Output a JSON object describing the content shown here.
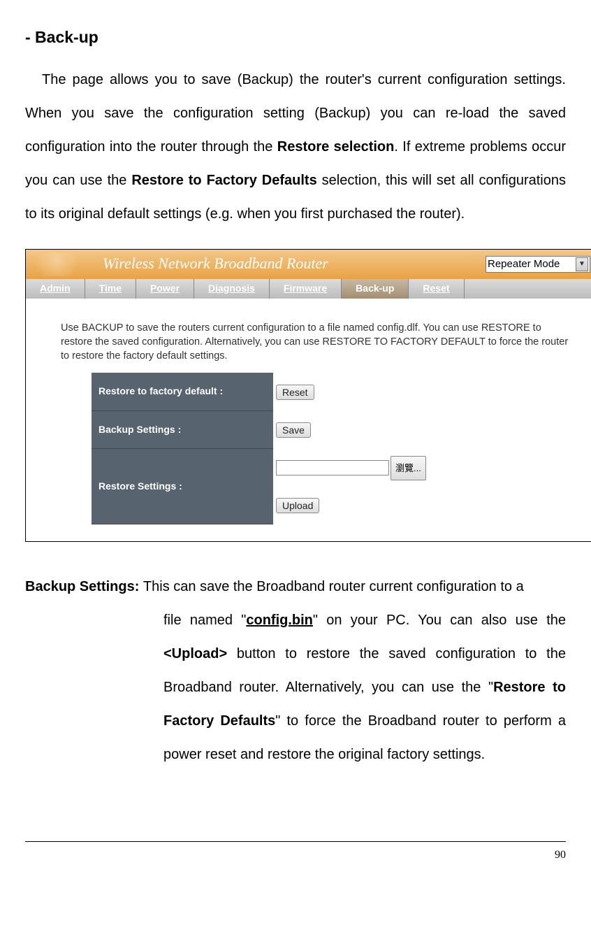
{
  "heading": "- Back-up",
  "intro": {
    "p1a": "The page allows you to save (Backup) the router's current configuration settings. When you save the configuration setting (Backup) you can re-load the saved configuration into the router through the ",
    "b1": "Restore selection",
    "p1b": ". If extreme problems occur you can use the ",
    "b2": "Restore to Factory Defaults",
    "p1c": " selection, this will set all configurations to its original default settings (e.g. when you first purchased the router)."
  },
  "router": {
    "title": "Wireless Network Broadband Router",
    "mode": "Repeater Mode",
    "tabs": [
      "Admin",
      "Time",
      "Power",
      "Diagnosis",
      "Firmware",
      "Back-up",
      "Reset"
    ],
    "active_tab": "Back-up",
    "desc": "Use BACKUP to save the routers current configuration to a file named config.dlf. You can use RESTORE to restore the saved configuration. Alternatively, you can use RESTORE TO FACTORY DEFAULT to force the router to restore the factory default settings.",
    "rows": {
      "factory_label": "Restore to factory default :",
      "factory_btn": "Reset",
      "backup_label": "Backup Settings :",
      "backup_btn": "Save",
      "restore_label": "Restore Settings :",
      "browse_btn": "瀏覽...",
      "upload_btn": "Upload"
    }
  },
  "definition": {
    "label": "Backup Settings: ",
    "line1_a": "This can save the Broadband router current configuration to a",
    "body_a": "file named \"",
    "config": "config.bin",
    "body_b": "\" on your PC. You can also use the ",
    "upload": "<Upload>",
    "body_c": " button to restore the saved configuration to the Broadband router. Alternatively, you can use the \"",
    "restore": "Restore to Factory Defaults",
    "body_d": "\" to force the Broadband router to perform a power reset and restore the original factory settings."
  },
  "page_number": "90"
}
